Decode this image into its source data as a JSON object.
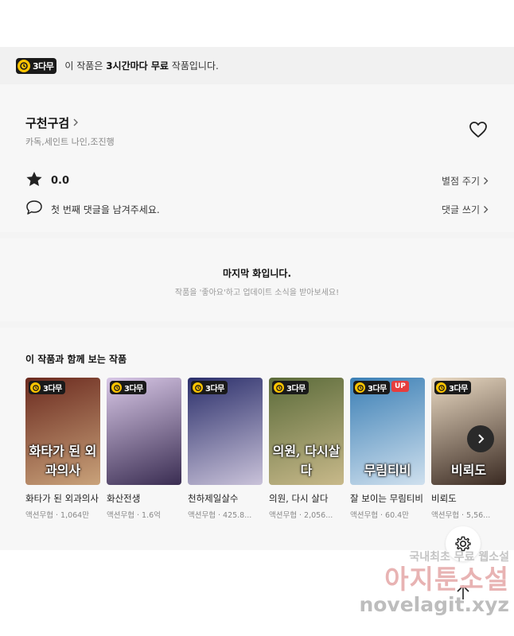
{
  "banner": {
    "badge_label": "3다무",
    "msg_prefix": "이 작품은 ",
    "msg_bold": "3시간마다 무료",
    "msg_suffix": " 작품입니다."
  },
  "work": {
    "title": "구천구검",
    "authors": "카독,세인트 나인,조진행",
    "rating": "0.0",
    "rate_link": "별점 주기",
    "comment_prompt": "첫 번째 댓글을 남겨주세요.",
    "comment_link": "댓글 쓰기"
  },
  "last_episode": {
    "title": "마지막 화입니다.",
    "subtitle": "작품을 '좋아요'하고 업데이트 소식을 받아보세요!"
  },
  "recommendations": {
    "heading": "이 작품과 함께 보는 작품",
    "items": [
      {
        "title": "화타가 된 외과의사",
        "genre": "액션무협",
        "views": "1,064만",
        "badge": "3다무",
        "up": "",
        "cover_text": "화타가 된 외과의사",
        "colors": [
          "#6b2a1f",
          "#c9a27a"
        ]
      },
      {
        "title": "화산전생",
        "genre": "액션무협",
        "views": "1.6억",
        "badge": "3다무",
        "up": "",
        "cover_text": "",
        "colors": [
          "#d8c7e6",
          "#3a2d52"
        ]
      },
      {
        "title": "천하제일살수",
        "genre": "액션무협",
        "views": "425.8...",
        "badge": "3다무",
        "up": "",
        "cover_text": "",
        "colors": [
          "#2b2f6b",
          "#c9c2d9"
        ]
      },
      {
        "title": "의원, 다시 살다",
        "genre": "액션무협",
        "views": "2,056...",
        "badge": "3다무",
        "up": "",
        "cover_text": "의원, 다시살다",
        "colors": [
          "#5b6b3a",
          "#c8b98a"
        ]
      },
      {
        "title": "잘 보이는 무림티비",
        "genre": "액션무협",
        "views": "60.4만",
        "badge": "3다무",
        "up": "UP",
        "cover_text": "무림티비",
        "colors": [
          "#3b7fb5",
          "#cfe0ee"
        ]
      },
      {
        "title": "비뢰도",
        "genre": "액션무협",
        "views": "5,56...",
        "badge": "3다무",
        "up": "",
        "cover_text": "비뢰도",
        "colors": [
          "#e9d9c2",
          "#3a2a22"
        ]
      }
    ]
  },
  "watermark": {
    "line1": "국내최초 무료 웹소설",
    "line2": "아지툰소설",
    "line3": "novelagit.xyz"
  },
  "colors": {
    "badge_clock": "#ffc400",
    "badge_bg": "#1a1a1a",
    "up_badge": "#e63d3d"
  }
}
